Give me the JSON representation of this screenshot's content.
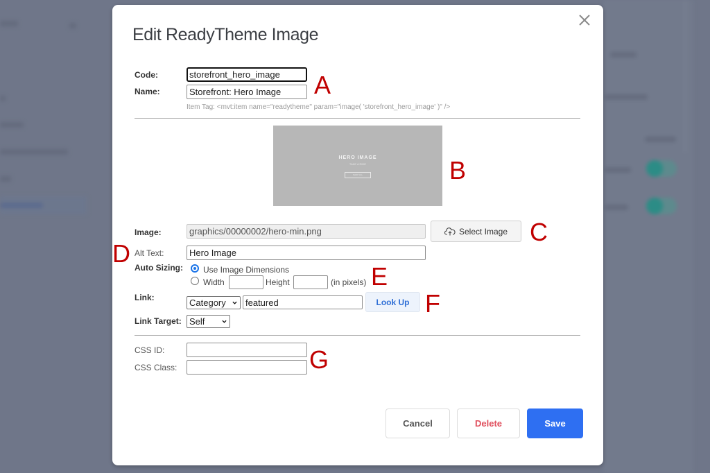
{
  "background": {
    "description": "blurred application page behind modal",
    "toggle_color": "#2c8c86"
  },
  "modal": {
    "title": "Edit ReadyTheme Image",
    "close_icon": "close-x-icon"
  },
  "form": {
    "code": {
      "label": "Code:",
      "value": "storefront_hero_image"
    },
    "name": {
      "label": "Name:",
      "value": "Storefront: Hero Image"
    },
    "item_tag": "Item Tag: <mvt:item name=\"readytheme\" param=\"image( 'storefront_hero_image' )\" />",
    "preview": {
      "title": "HERO IMAGE",
      "subtitle": "TAKE A RIDE",
      "button": "SHOP ALL"
    },
    "image": {
      "label": "Image:",
      "value": "graphics/00000002/hero-min.png"
    },
    "select_image": {
      "label": "Select Image",
      "icon": "cloud-upload-icon"
    },
    "alt_text": {
      "label": "Alt Text:",
      "value": "Hero Image"
    },
    "auto_sizing": {
      "label": "Auto Sizing:",
      "option_dimensions": "Use Image Dimensions",
      "option_custom": "Width",
      "height_label": "Height",
      "unit_label": "(in pixels)",
      "selected": "Use Image Dimensions",
      "width_value": "",
      "height_value": ""
    },
    "link": {
      "label": "Link:",
      "type": "Category",
      "value": "featured",
      "lookup_label": "Look Up"
    },
    "link_target": {
      "label": "Link Target:",
      "value": "Self"
    },
    "css_id": {
      "label": "CSS ID:",
      "value": ""
    },
    "css_class": {
      "label": "CSS Class:",
      "value": ""
    }
  },
  "footer": {
    "cancel": "Cancel",
    "delete": "Delete",
    "save": "Save",
    "save_color": "#2e6ff2",
    "delete_color": "#e0505e"
  },
  "annotations": {
    "a": "A",
    "b": "B",
    "c": "C",
    "d": "D",
    "e": "E",
    "f": "F",
    "g": "G",
    "color": "#c00000"
  }
}
